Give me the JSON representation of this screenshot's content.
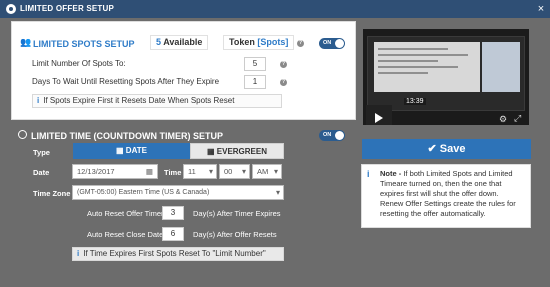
{
  "titlebar": {
    "title": "LIMITED OFFER SETUP",
    "close": "×"
  },
  "spots": {
    "title": "LIMITED SPOTS SETUP",
    "available_count": "5",
    "available_label": "Available",
    "token_label": "Token",
    "token_value": "[Spots]",
    "toggle": "ON",
    "limit_label": "Limit Number Of Spots To:",
    "limit_value": "5",
    "reset_label": "Days To Wait Until Resetting Spots After They Expire",
    "reset_value": "1",
    "hint": "If Spots Expire First it Resets Date When Spots Reset"
  },
  "timer": {
    "title": "LIMITED TIME (COUNTDOWN TIMER) SETUP",
    "toggle": "ON",
    "type_label": "Type",
    "type_date": "DATE",
    "type_evergreen": "EVERGREEN",
    "date_label": "Date",
    "date_value": "12/13/2017",
    "time_label": "Time",
    "hour": "11",
    "minute": "00",
    "ampm": "AM",
    "timezone_label": "Time Zone",
    "timezone_value": "(GMT-05:00) Eastern Time (US & Canada)",
    "auto_reset_timer_label": "Auto Reset Offer Timer",
    "auto_reset_timer_value": "3",
    "auto_reset_timer_suffix": "Day(s) After Timer Expires",
    "auto_reset_close_label": "Auto Reset Close Date",
    "auto_reset_close_value": "6",
    "auto_reset_close_suffix": "Day(s) After Offer Resets",
    "hint": "If Time Expires First Spots Reset To \"Limit Number\""
  },
  "video": {
    "time": "13:39"
  },
  "save_label": "Save",
  "note": {
    "bold": "Note - ",
    "text": "If both Limited Spots and Limited Timeare turned on, then the one that expires first will shut the offer down. Renew Offer Settings create the rules for resetting the offer automatically."
  },
  "colors": {
    "accent": "#2d73b8",
    "titlebar": "#2f4f75",
    "toggle": "#2b5c8f"
  },
  "icons": [
    "users-icon",
    "question-icon",
    "info-icon",
    "clock-icon",
    "calendar-icon",
    "check-icon",
    "play-icon",
    "gear-icon",
    "fullscreen-icon",
    "close-icon"
  ]
}
